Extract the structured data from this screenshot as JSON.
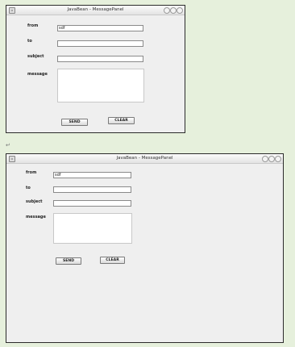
{
  "window_title": "JavaBean - MessagePanel",
  "form": {
    "from_label": "from",
    "to_label": "to",
    "subject_label": "subject",
    "message_label": "message",
    "from_value": "sdf",
    "to_value": "",
    "subject_value": "",
    "message_value": ""
  },
  "buttons": {
    "send": "SEND",
    "clear": "CLEAR"
  },
  "separator": "↵"
}
